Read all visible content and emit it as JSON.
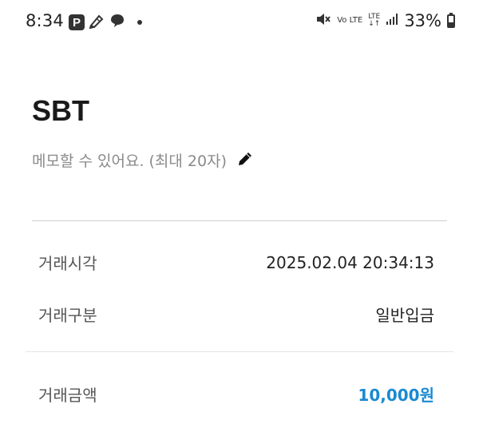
{
  "status_bar": {
    "time": "8:34",
    "p_icon_label": "P",
    "volte_label": "Vo LTE",
    "lte_label": "LTE",
    "battery_percent": "33%",
    "battery_level": 0.33
  },
  "account": {
    "title": "SBT",
    "memo_placeholder": "메모할 수 있어요. (최대 20자)"
  },
  "details": [
    {
      "label": "거래시각",
      "value": "2025.02.04 20:34:13"
    },
    {
      "label": "거래구분",
      "value": "일반입금"
    }
  ],
  "amount": {
    "label": "거래금액",
    "value": "10,000원",
    "color": "#1a8ad1"
  }
}
